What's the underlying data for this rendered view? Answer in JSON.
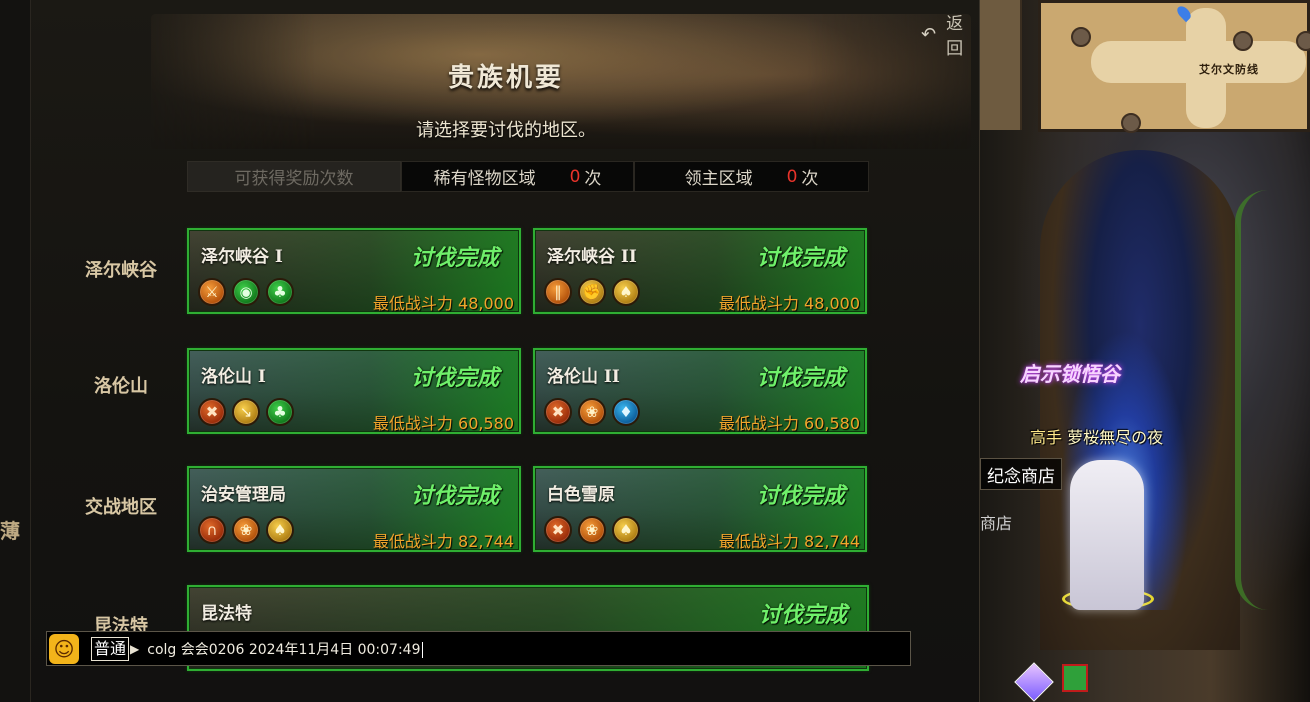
{
  "panel": {
    "back_label": "返回",
    "title": "贵族机要",
    "subtitle": "请选择要讨伐的地区。",
    "reward": {
      "label": "可获得奖励次数",
      "rare_label": "稀有怪物区域",
      "rare_count": "0",
      "boss_label": "领主区域",
      "boss_count": "0",
      "unit": "次"
    },
    "regions": [
      {
        "name": "泽尔峡谷",
        "dungeons": [
          {
            "name": "泽尔峡谷 I",
            "status": "讨伐完成",
            "power_label": "最低战斗力",
            "power": "48,000",
            "icons": [
              "orange",
              "green",
              "green"
            ]
          },
          {
            "name": "泽尔峡谷 II",
            "status": "讨伐完成",
            "power_label": "最低战斗力",
            "power": "48,000",
            "icons": [
              "orange",
              "gold",
              "gold"
            ]
          }
        ]
      },
      {
        "name": "洛伦山",
        "dungeons": [
          {
            "name": "洛伦山 I",
            "status": "讨伐完成",
            "power_label": "最低战斗力",
            "power": "60,580",
            "icons": [
              "red",
              "gold",
              "green"
            ]
          },
          {
            "name": "洛伦山 II",
            "status": "讨伐完成",
            "power_label": "最低战斗力",
            "power": "60,580",
            "icons": [
              "red",
              "orange",
              "blue"
            ]
          }
        ]
      },
      {
        "name": "交战地区",
        "dungeons": [
          {
            "name": "治安管理局",
            "status": "讨伐完成",
            "power_label": "最低战斗力",
            "power": "82,744",
            "icons": [
              "red",
              "orange",
              "gold"
            ]
          },
          {
            "name": "白色雪原",
            "status": "讨伐完成",
            "power_label": "最低战斗力",
            "power": "82,744",
            "icons": [
              "red",
              "orange",
              "gold"
            ]
          }
        ]
      },
      {
        "name": "昆法特",
        "dungeons": [
          {
            "name": "昆法特",
            "status": "讨伐完成"
          }
        ]
      }
    ]
  },
  "chat": {
    "mode": "普通",
    "text": "colg 会会0206 2024年11月4日 00:07:49"
  },
  "world": {
    "minimap_label": "艾尔文防线",
    "portal_text": "启示锁悟谷",
    "player_level": "高手",
    "player_name": "萝桜無尽の夜",
    "shop_sign": "纪念商店",
    "shop_sign2": "商店"
  },
  "colors": {
    "done_text": "#6ff06a",
    "power_text": "#f1a52b",
    "card_border": "#2fae33",
    "count_red": "#e8332a"
  }
}
